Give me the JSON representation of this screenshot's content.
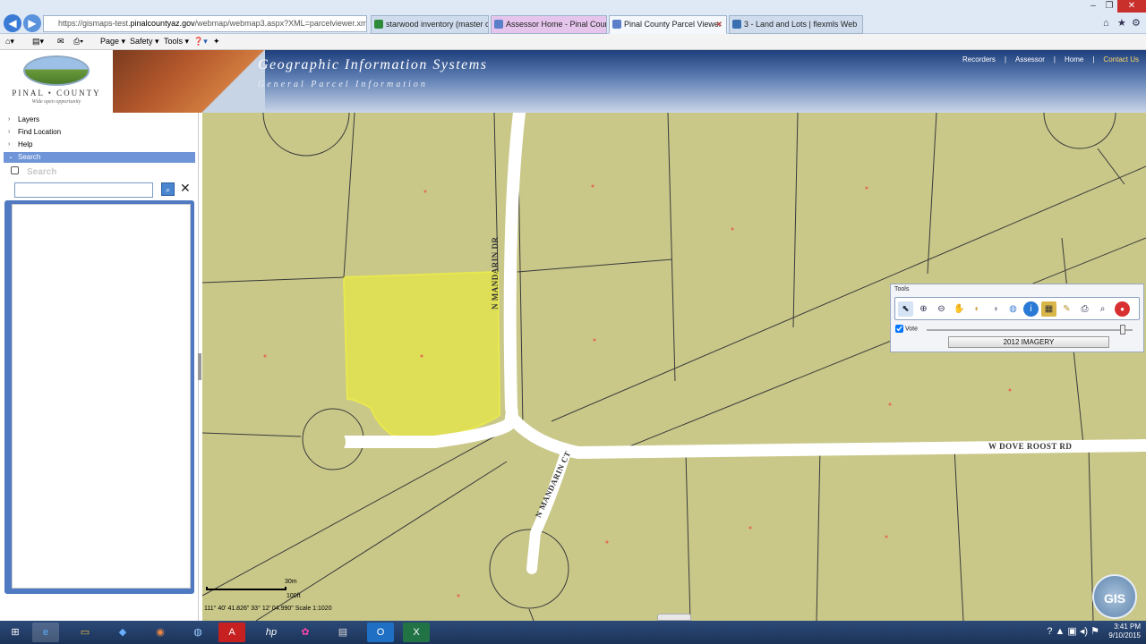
{
  "browser": {
    "url_prefix": "https://gismaps-test.",
    "url_domain": "pinalcountyaz.gov",
    "url_path": "/webmap/webmap3.aspx?XML=parcelviewer.xm",
    "tabs": [
      {
        "label": "starwood inventory (master co...",
        "color": "#2e8b3a"
      },
      {
        "label": "Assessor Home - Pinal County",
        "color": "#5b7fc9"
      },
      {
        "label": "Pinal County Parcel Viewer",
        "color": "#5b7fc9"
      },
      {
        "label": "3 - Land and Lots | flexmls Web",
        "color": "#3a6fb0"
      }
    ],
    "menu": {
      "page": "Page ▾",
      "safety": "Safety ▾",
      "tools": "Tools ▾"
    }
  },
  "header": {
    "county_name": "PINAL • COUNTY",
    "tagline": "Wide open opportunity",
    "title": "Geographic Information Systems",
    "subtitle": "General Parcel Information",
    "links": [
      "Recorders",
      "Assessor",
      "Home",
      "Contact Us"
    ]
  },
  "sidebar": {
    "items": [
      {
        "label": "Layers"
      },
      {
        "label": "Find Location"
      },
      {
        "label": "Help"
      },
      {
        "label": "Search"
      }
    ],
    "search_title": "Search",
    "search_value": ""
  },
  "map": {
    "roads": {
      "mandarin_dr": "N MANDARIN DR",
      "mandarin_ct": "N MANDARIN CT",
      "dove_roost": "W DOVE ROOST RD"
    },
    "colors": {
      "land": "#c9c889",
      "selected_parcel": "#dede57",
      "road": "#ffffff",
      "parcel_line": "#3a3a3a"
    },
    "scale_30m": "30m",
    "scale_100ft": "100ft",
    "coordinates": "111° 40' 41.826\"   33° 12' 04.990\"   Scale 1:1020",
    "gis_badge": "GIS"
  },
  "tools": {
    "title": "Tools",
    "icons": [
      "select-icon",
      "zoom-in-icon",
      "zoom-out-icon",
      "pan-icon",
      "zoom-prev-icon",
      "zoom-next-icon",
      "globe-icon",
      "info-icon",
      "map-icon",
      "measure-icon",
      "print-icon",
      "search-zoom-icon",
      "stop-icon"
    ],
    "vote_label": "Vote",
    "vote_checked": true,
    "imagery_label": "2012 IMAGERY"
  },
  "taskbar": {
    "time": "3:41 PM",
    "date": "9/10/2015"
  }
}
